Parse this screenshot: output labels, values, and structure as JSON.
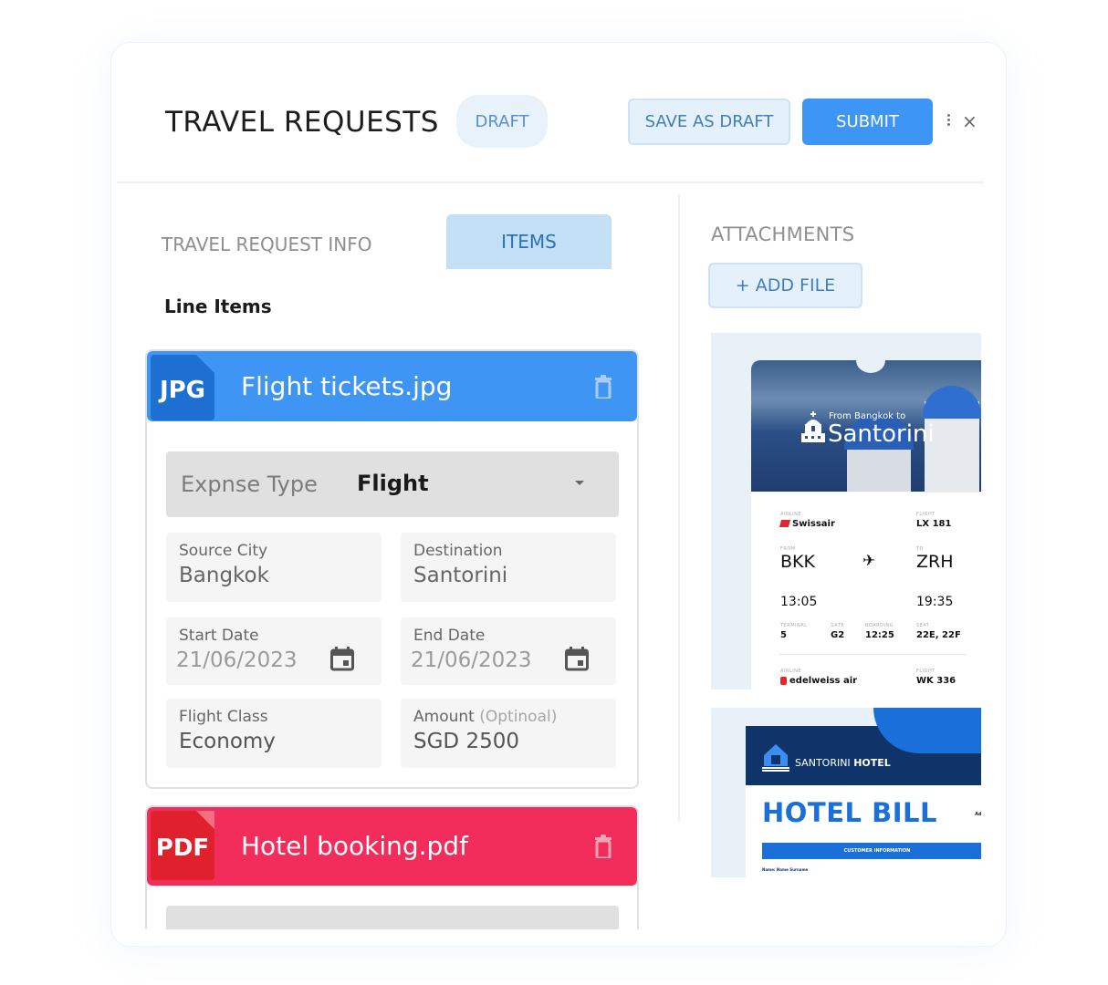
{
  "header": {
    "title": "TRAVEL REQUESTS",
    "status_badge": "DRAFT",
    "save_draft_label": "SAVE AS DRAFT",
    "submit_label": "SUBMIT",
    "more_icon": "more-vertical-icon",
    "close_icon": "×"
  },
  "tabs": [
    {
      "label": "TRAVEL REQUEST INFO",
      "active": false
    },
    {
      "label": "ITEMS",
      "active": true
    }
  ],
  "line_items": {
    "title": "Line Items",
    "items": [
      {
        "file_type": "JPG",
        "file_name": "Flight tickets.jpg",
        "color": "#3f95f3",
        "expense_type_label": "Expnse Type",
        "expense_type_value": "Flight",
        "fields": {
          "source_city": {
            "label": "Source City",
            "value": "Bangkok"
          },
          "destination": {
            "label": "Destination",
            "value": "Santorini"
          },
          "start_date": {
            "label": "Start Date",
            "value": "21/06/2023"
          },
          "end_date": {
            "label": "End Date",
            "value": "21/06/2023"
          },
          "flight_class": {
            "label": "Flight Class",
            "value": "Economy"
          },
          "amount": {
            "label": "Amount",
            "label_suffix": "(Optinoal)",
            "value": "SGD 2500"
          }
        }
      },
      {
        "file_type": "PDF",
        "file_name": "Hotel booking.pdf",
        "color": "#f22d5c"
      }
    ]
  },
  "attachments": {
    "title": "ATTACHMENTS",
    "add_file_label": "+ ADD FILE",
    "flight_ticket": {
      "from_text": "From Bangkok to",
      "destination": "Santorini",
      "segment_1": {
        "airline_caption": "AIRLINE",
        "airline": "Swissair",
        "flight_caption": "FLIGHT",
        "flight": "LX 181",
        "from_caption": "FROM",
        "from": "BKK",
        "to_caption": "TO",
        "to": "ZRH",
        "depart_time": "13:05",
        "arrive_time": "19:35",
        "terminal_caption": "TERMINAL",
        "terminal": "5",
        "gate_caption": "GATE",
        "gate": "G2",
        "boarding_caption": "BOARDING",
        "boarding": "12:25",
        "seat_caption": "SEAT",
        "seat": "22E, 22F"
      },
      "segment_2": {
        "airline_caption": "AIRLINE",
        "airline": "edelweiss air",
        "flight_caption": "FLIGHT",
        "flight": "WK 336"
      },
      "plane_icon": "✈"
    },
    "hotel_bill": {
      "hotel_name_light": "SANTORINI",
      "hotel_name_bold": "HOTEL",
      "title": "HOTEL BILL",
      "address_label": "Addre",
      "section_bar": "CUSTOMER INFORMATION",
      "name_line": "Name: Name Surname"
    }
  }
}
